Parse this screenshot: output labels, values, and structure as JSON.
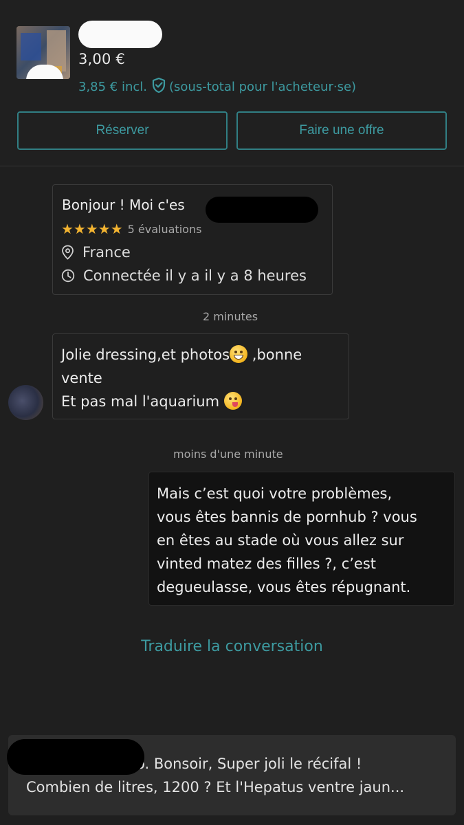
{
  "item": {
    "price": "3,00 €",
    "price_incl": "3,85 € incl.",
    "buyer_subtotal": "(sous-total pour l'acheteur·se)",
    "shield_icon": "shield-check-icon",
    "accent_color": "#3d9aa0"
  },
  "actions": {
    "reserve_label": "Réserver",
    "offer_label": "Faire une offre"
  },
  "profile": {
    "greeting": "Bonjour ! Moi c'es",
    "stars": "★★★★★",
    "rating_count": "5 évaluations",
    "location": "France",
    "last_seen": "Connectée il y a il y a 8 heures",
    "star_color": "#f3b431"
  },
  "messages": [
    {
      "time": "2 minutes",
      "line1": "Jolie dressing,et photos",
      "line1_end": " ,bonne",
      "line2": "vente",
      "line3": "Et pas mal l'aquarium "
    },
    {
      "time": "moins d'une minute",
      "lines": [
        "Mais c’est quoi votre problèmes,",
        "vous êtes bannis de pornhub ? vous",
        "en êtes au stade où vous allez sur",
        "vinted matez des filles ?, c’est",
        "degueulasse, vous êtes répugnant."
      ]
    }
  ],
  "translate_label": "Traduire la conversation",
  "preview": {
    "line1": "o. Bonsoir, Super joli le récifal !",
    "line2": "Combien de litres, 1200 ? Et l'Hepatus ventre jaun..."
  }
}
